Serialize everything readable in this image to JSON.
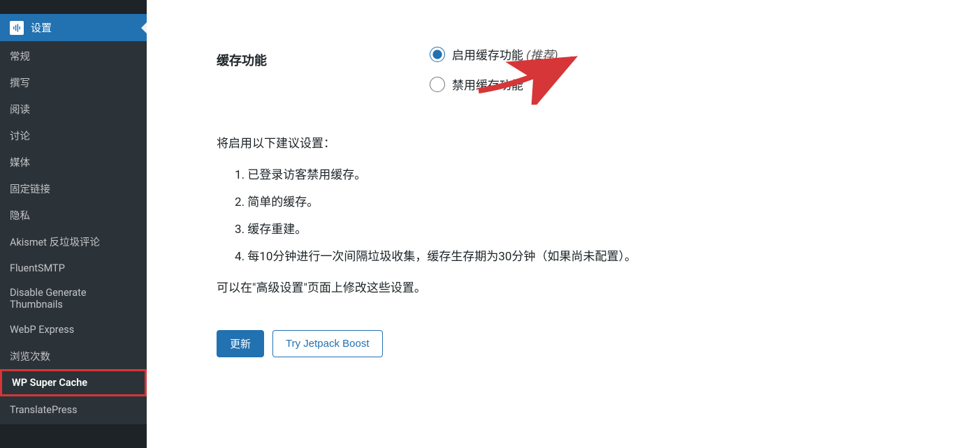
{
  "sidebar": {
    "main_label": "设置",
    "sub_items": [
      {
        "label": "常规"
      },
      {
        "label": "撰写"
      },
      {
        "label": "阅读"
      },
      {
        "label": "讨论"
      },
      {
        "label": "媒体"
      },
      {
        "label": "固定链接"
      },
      {
        "label": "隐私"
      },
      {
        "label": "Akismet 反垃圾评论"
      },
      {
        "label": "FluentSMTP"
      },
      {
        "label": "Disable Generate Thumbnails"
      },
      {
        "label": "WebP Express"
      },
      {
        "label": "浏览次数"
      },
      {
        "label": "WP Super Cache",
        "current": true
      },
      {
        "label": "TranslatePress"
      }
    ]
  },
  "main": {
    "section_label": "缓存功能",
    "radio_enable_label": "启用缓存功能 ",
    "radio_enable_hint": "(推荐)",
    "radio_disable_label": "禁用缓存功能",
    "sub_heading": "将启用以下建议设置：",
    "settings": [
      "已登录访客禁用缓存。",
      "简单的缓存。",
      "缓存重建。",
      "每10分钟进行一次间隔垃圾收集，缓存生存期为30分钟（如果尚未配置）。"
    ],
    "note": "可以在\"高级设置\"页面上修改这些设置。",
    "update_button": "更新",
    "try_jetpack_button": "Try Jetpack Boost"
  }
}
